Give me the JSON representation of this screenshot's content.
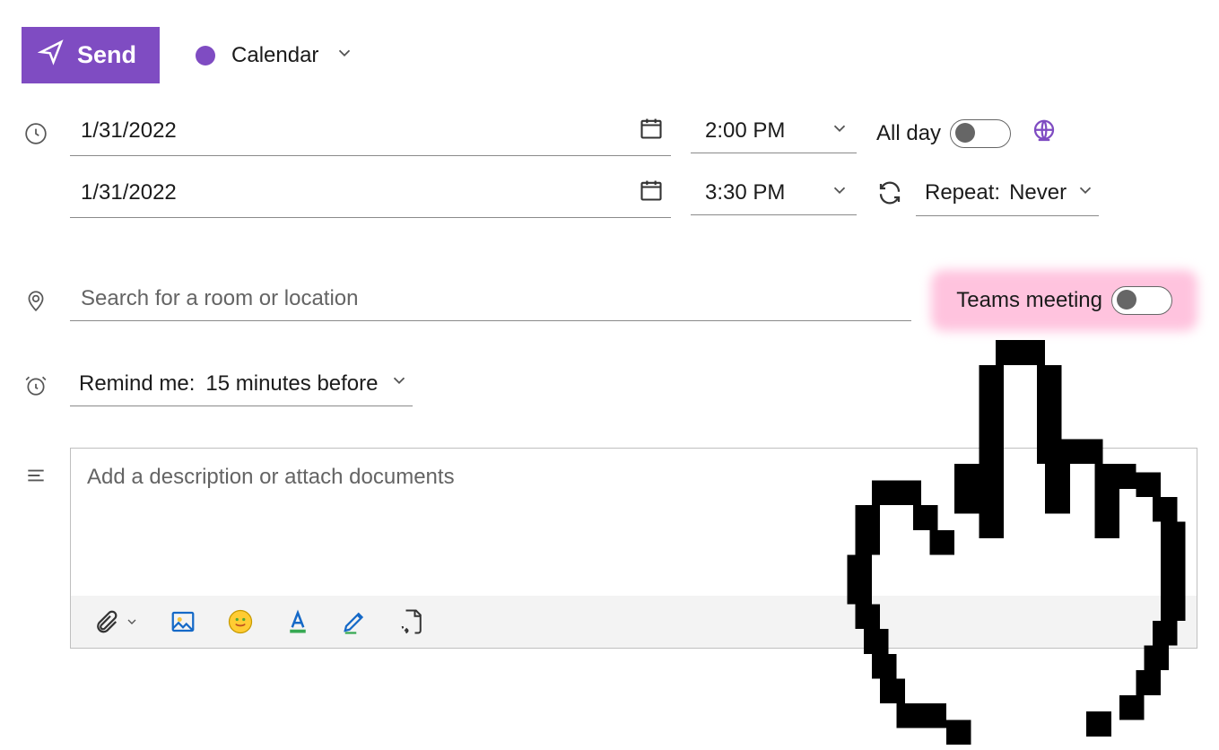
{
  "toolbar": {
    "send_label": "Send",
    "calendar_label": "Calendar"
  },
  "dates": {
    "start_date": "1/31/2022",
    "start_time": "2:00 PM",
    "end_date": "1/31/2022",
    "end_time": "3:30 PM"
  },
  "all_day_label": "All day",
  "repeat_label_prefix": "Repeat:",
  "repeat_value": "Never",
  "location_placeholder": "Search for a room or location",
  "teams_label": "Teams meeting",
  "remind_label_prefix": "Remind me:",
  "remind_value": "15 minutes before",
  "description_placeholder": "Add a description or attach documents"
}
